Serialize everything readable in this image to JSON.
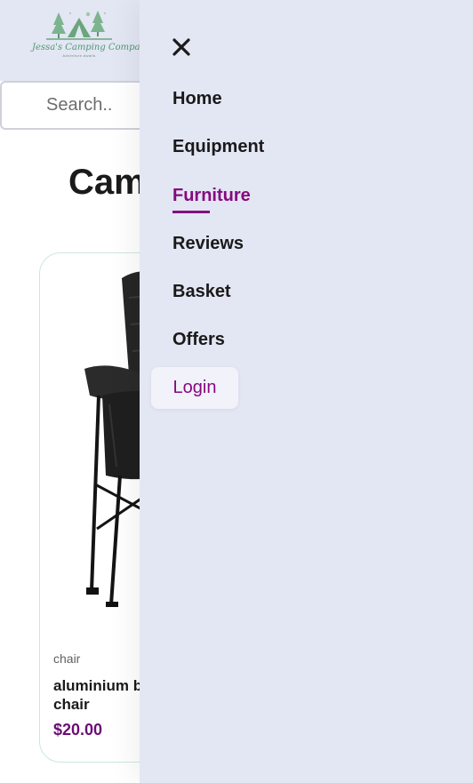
{
  "header": {
    "logo": {
      "brand": "Jessa's Camping Company",
      "tagline": "Adventure Awaits"
    }
  },
  "search": {
    "placeholder": "Search.."
  },
  "main": {
    "section_title": "Camping Chairs",
    "products": [
      {
        "image": "folding-camping-chair-photo",
        "category": "chair",
        "name": "aluminium beach chair",
        "price": "$20.00"
      }
    ]
  },
  "menu": {
    "close_icon": "close-icon",
    "items": [
      {
        "label": "Home",
        "active": false
      },
      {
        "label": "Equipment",
        "active": false
      },
      {
        "label": "Furniture",
        "active": true
      },
      {
        "label": "Reviews",
        "active": false
      },
      {
        "label": "Basket",
        "active": false
      },
      {
        "label": "Offers",
        "active": false
      }
    ],
    "login_label": "Login"
  },
  "colors": {
    "menu_background": "#e3e6f3",
    "accent": "#86097f",
    "price": "#6a0e72",
    "logo_green": "#6aa57c"
  }
}
